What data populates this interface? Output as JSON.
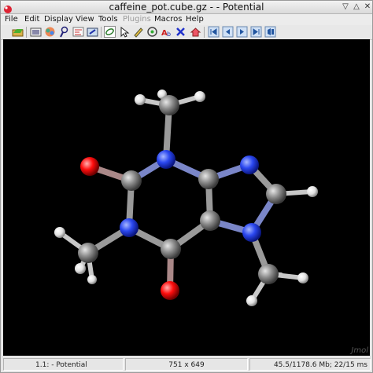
{
  "window": {
    "title": "caffeine_pot.cube.gz - - Potential",
    "controls": [
      "minimize-icon",
      "maximize-icon",
      "close-icon"
    ]
  },
  "menu": {
    "items": [
      {
        "label": "File",
        "enabled": true
      },
      {
        "label": "Edit",
        "enabled": true
      },
      {
        "label": "Display",
        "enabled": true
      },
      {
        "label": "View",
        "enabled": true
      },
      {
        "label": "Tools",
        "enabled": true
      },
      {
        "label": "Plugins",
        "enabled": false
      },
      {
        "label": "Macros",
        "enabled": true
      },
      {
        "label": "Help",
        "enabled": true
      }
    ]
  },
  "toolbar": {
    "buttons": [
      "open-icon",
      "screenshot-icon",
      "display-icon",
      "pick-icon",
      "preferences-icon",
      "export-icon",
      "rotate-icon",
      "select-icon",
      "draw-icon",
      "measure-icon",
      "label-icon",
      "delete-icon",
      "home-icon",
      "first-frame-icon",
      "prev-frame-icon",
      "next-frame-icon",
      "last-frame-icon",
      "play-icon"
    ]
  },
  "viewer": {
    "background": "#000000",
    "watermark": "Jmol",
    "molecule": "caffeine",
    "atom_colors": {
      "carbon": "#8c8c8c",
      "nitrogen": "#2b48f0",
      "oxygen": "#ff0d0d",
      "hydrogen": "#ffffff"
    }
  },
  "status": {
    "model": "1.1:  - Potential",
    "size": "751 x 649",
    "memory": "45.5/1178.6 Mb;  22/15 ms"
  }
}
